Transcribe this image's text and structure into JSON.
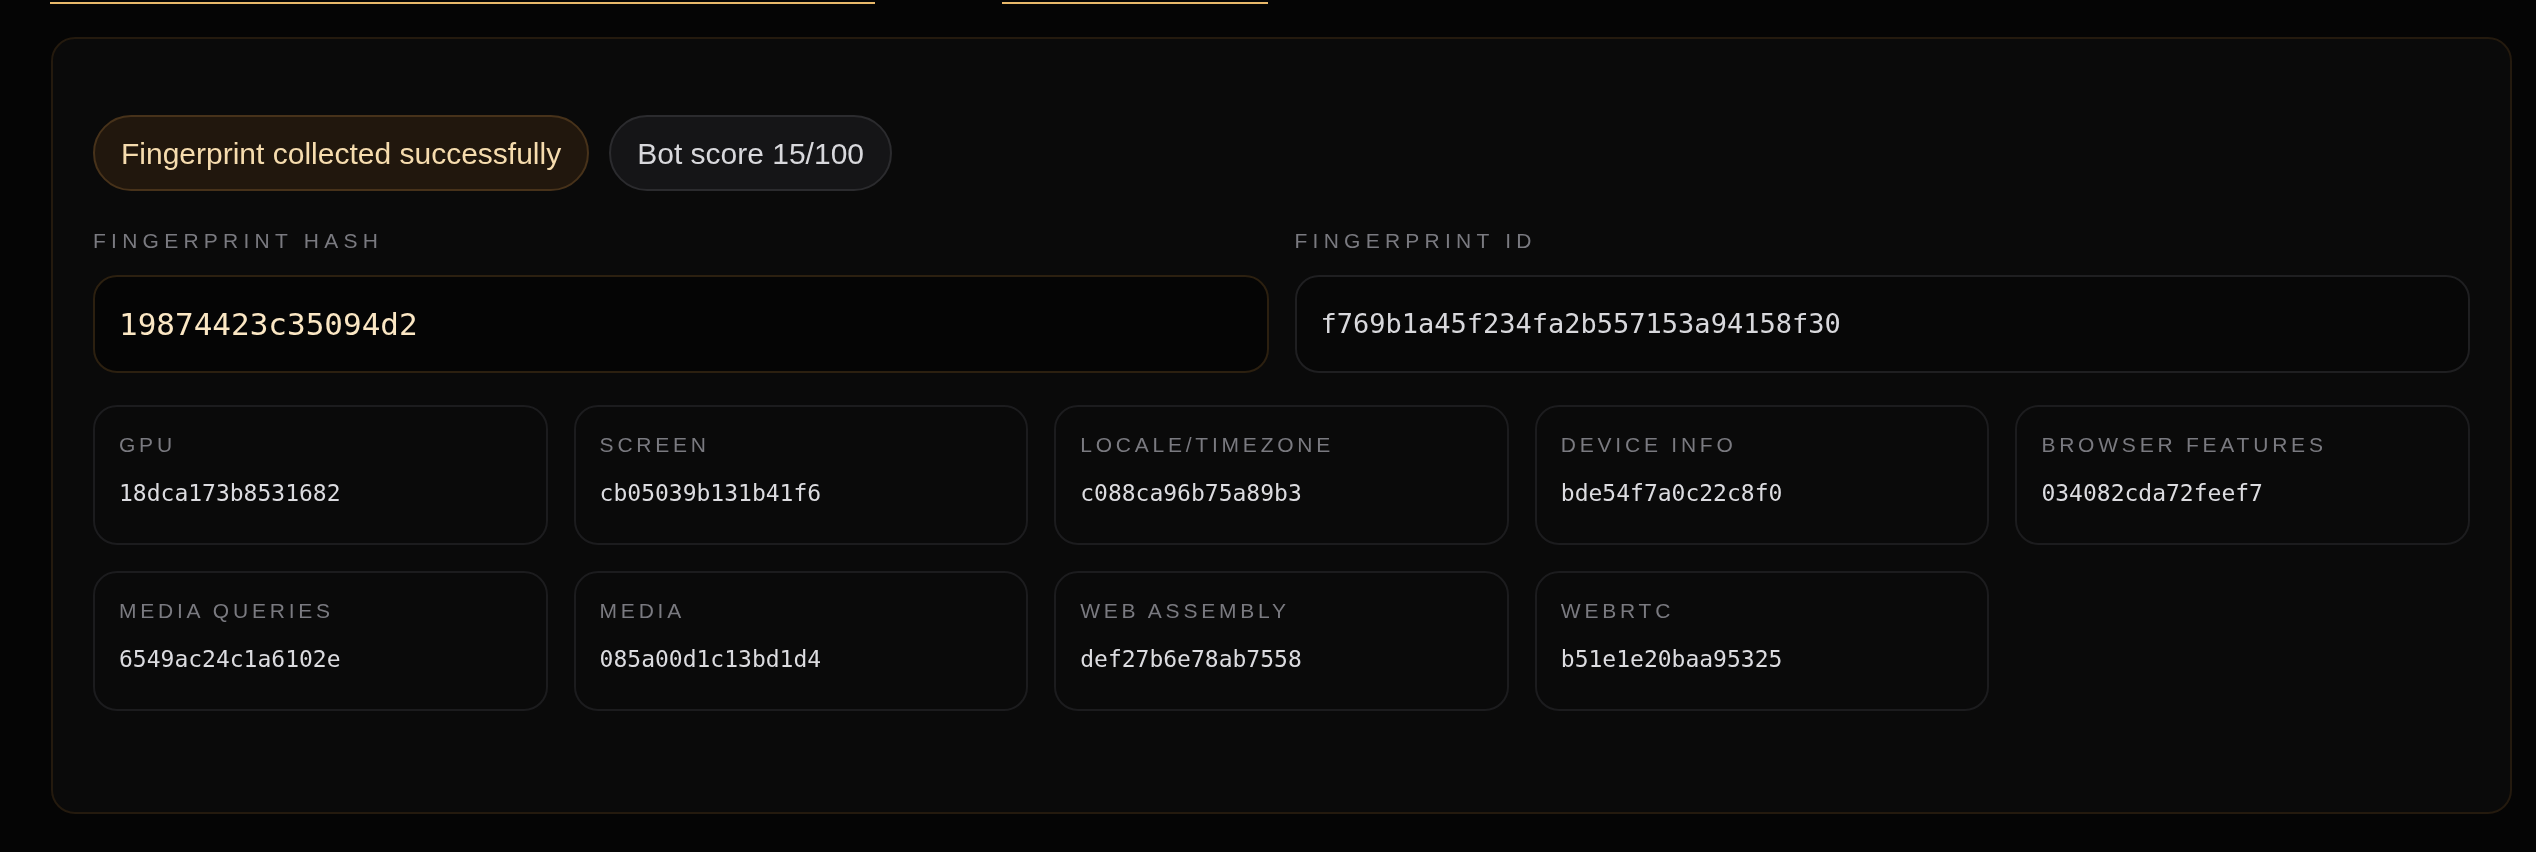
{
  "badges": [
    {
      "kind": "success",
      "text": "Fingerprint collected successfully"
    },
    {
      "kind": "neutral",
      "text": "Bot score 15/100"
    }
  ],
  "hashes": [
    {
      "kind": "primary",
      "label": "FINGERPRINT HASH",
      "value": "19874423c35094d2"
    },
    {
      "kind": "plain",
      "label": "FINGERPRINT ID",
      "value": "f769b1a45f234fa2b557153a94158f30"
    }
  ],
  "components": [
    {
      "label": "GPU",
      "value": "18dca173b8531682"
    },
    {
      "label": "SCREEN",
      "value": "cb05039b131b41f6"
    },
    {
      "label": "LOCALE/TIMEZONE",
      "value": "c088ca96b75a89b3"
    },
    {
      "label": "DEVICE INFO",
      "value": "bde54f7a0c22c8f0"
    },
    {
      "label": "BROWSER FEATURES",
      "value": "034082cda72feef7"
    },
    {
      "label": "MEDIA QUERIES",
      "value": "6549ac24c1a6102e"
    },
    {
      "label": "MEDIA",
      "value": "085a00d1c13bd1d4"
    },
    {
      "label": "WEB ASSEMBLY",
      "value": "def27b6e78ab7558"
    },
    {
      "label": "WEBRTC",
      "value": "b51e1e20baa95325"
    }
  ]
}
